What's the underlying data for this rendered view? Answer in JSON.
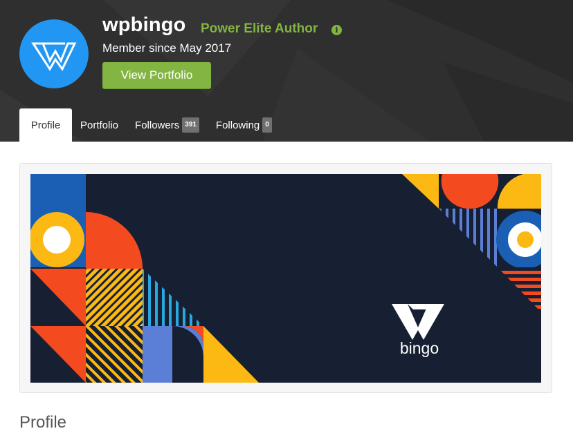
{
  "author": {
    "username": "wpbingo",
    "badge_title": "Power Elite Author",
    "member_since": "Member since May 2017",
    "view_portfolio_label": "View Portfolio"
  },
  "tabs": [
    {
      "label": "Profile",
      "active": true
    },
    {
      "label": "Portfolio"
    },
    {
      "label": "Followers",
      "count": "391"
    },
    {
      "label": "Following",
      "count": "0"
    }
  ],
  "banner": {
    "logo_text": "bingo"
  },
  "section": {
    "heading": "Profile"
  },
  "icons": {
    "info": "info-icon",
    "avatar_logo": "wpbingo-logo-icon"
  },
  "colors": {
    "header_bg": "#2f2f2f",
    "accent_green": "#82b541",
    "avatar_blue": "#2196f3",
    "banner_bg": "#172033",
    "banner_red": "#f44a1f",
    "banner_yellow": "#fdb913",
    "banner_blue": "#1a5fb4",
    "banner_cyan": "#29a8e0"
  }
}
